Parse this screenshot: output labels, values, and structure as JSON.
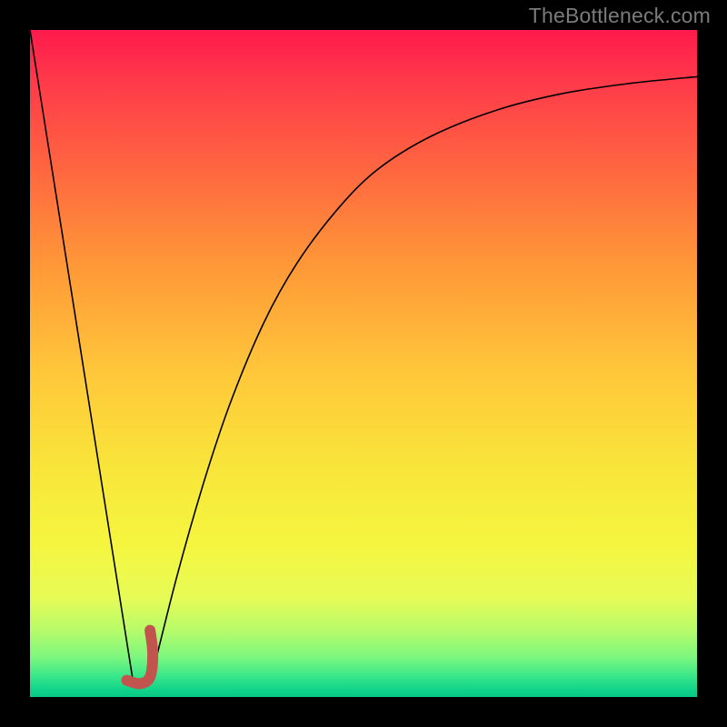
{
  "watermark": "TheBottleneck.com",
  "chart_data": {
    "type": "line",
    "title": "",
    "xlabel": "",
    "ylabel": "",
    "xlim": [
      0,
      100
    ],
    "ylim": [
      0,
      100
    ],
    "background_gradient": {
      "direction": "top-to-bottom",
      "stops": [
        {
          "pos": 0,
          "color": "#ff1a4d"
        },
        {
          "pos": 50,
          "color": "#ffd23a"
        },
        {
          "pos": 80,
          "color": "#f5f53f"
        },
        {
          "pos": 100,
          "color": "#09c985"
        }
      ]
    },
    "series": [
      {
        "name": "left-branch",
        "color": "#000000",
        "width": 1.6,
        "x": [
          0,
          15.5
        ],
        "y": [
          100,
          2
        ]
      },
      {
        "name": "right-branch-curve",
        "color": "#000000",
        "width": 1.6,
        "x": [
          18,
          22,
          26,
          30,
          35,
          40,
          46,
          52,
          60,
          70,
          80,
          90,
          100
        ],
        "y": [
          2,
          18,
          32,
          44,
          56,
          65,
          73,
          79,
          84,
          88,
          90.5,
          92,
          93
        ]
      },
      {
        "name": "marker-j-shape",
        "color": "#c1554e",
        "width": 10,
        "x": [
          14.5,
          16.5,
          18.0,
          18.4,
          18.0
        ],
        "y": [
          2.5,
          2.0,
          3.0,
          6.5,
          10.0
        ]
      }
    ]
  }
}
